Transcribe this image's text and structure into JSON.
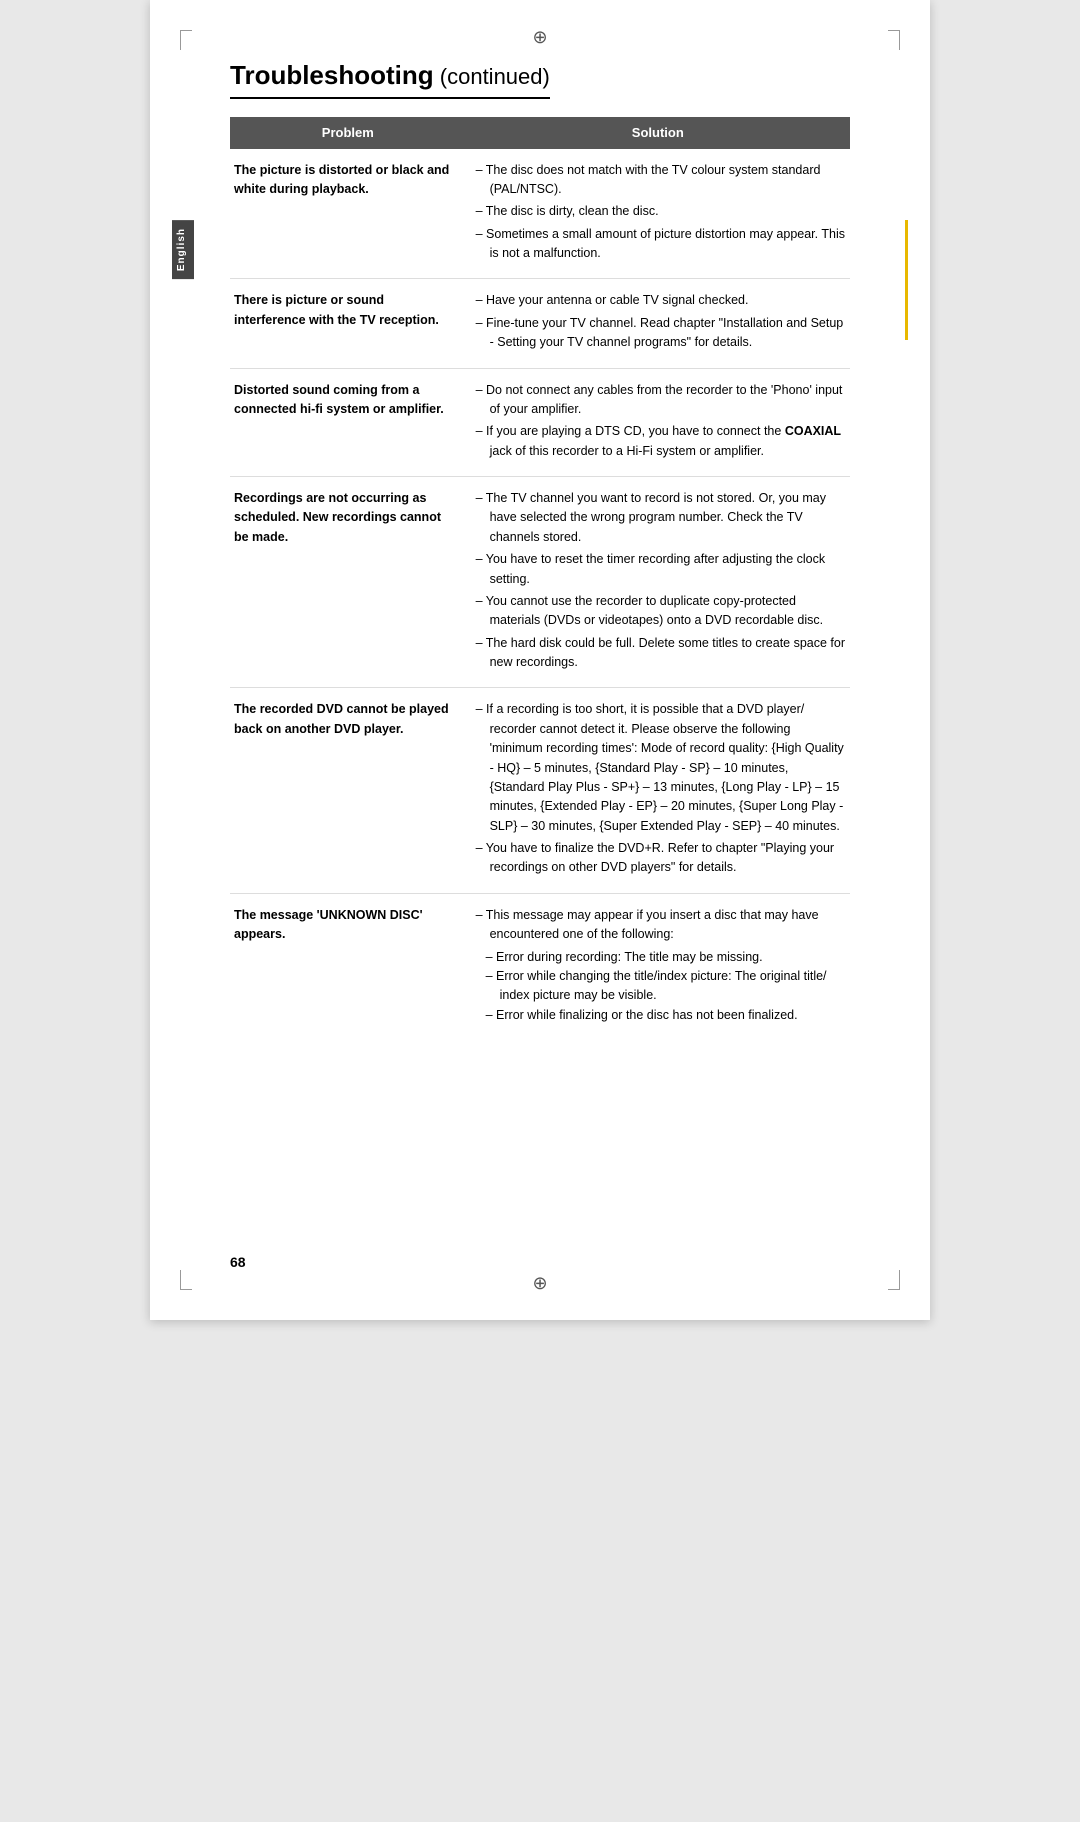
{
  "page": {
    "number": "68",
    "reg_mark": "⊕",
    "sidebar_label": "English",
    "title_bold": "Troubleshooting",
    "title_normal": " (continued)"
  },
  "table": {
    "header": {
      "problem": "Problem",
      "solution": "Solution"
    },
    "rows": [
      {
        "problem": "The picture is distorted or black and white during playback.",
        "solutions": [
          "The disc does not match with the TV colour system standard (PAL/NTSC).",
          "The disc is dirty, clean the disc.",
          "Sometimes a small amount of picture distortion may appear. This is not a malfunction."
        ]
      },
      {
        "problem": "There is picture or sound interference with the TV reception.",
        "solutions": [
          "Have your antenna or cable TV signal checked.",
          "Fine-tune your TV channel. Read chapter \"Installation and Setup - Setting your TV channel programs\" for details."
        ]
      },
      {
        "problem": "Distorted sound coming from a connected hi-fi system or amplifier.",
        "solutions": [
          "Do not connect any cables from the recorder to the 'Phono' input of your amplifier.",
          "If you are playing a DTS CD, you have to connect the COAXIAL jack of this recorder to a Hi-Fi system or amplifier."
        ],
        "bold_keyword": "COAXIAL"
      },
      {
        "problem": "Recordings are not occurring as scheduled. New recordings cannot be made.",
        "solutions": [
          "The TV channel you want to record is not stored. Or, you may have selected the wrong program number. Check the TV channels stored.",
          "You have to reset the timer recording after adjusting the clock setting.",
          "You cannot use the recorder to duplicate copy-protected materials (DVDs or videotapes) onto a DVD recordable disc.",
          "The hard disk could be full. Delete some titles to create space for new recordings."
        ]
      },
      {
        "problem": "The recorded DVD cannot be played back on another DVD player.",
        "solutions": [
          "If a recording is too short, it is possible that a DVD player/ recorder cannot detect it. Please observe the following 'minimum recording times': Mode of record quality: {High Quality - HQ} – 5 minutes, {Standard Play - SP} – 10 minutes, {Standard Play Plus - SP+} – 13 minutes, {Long Play - LP} – 15 minutes, {Extended Play - EP} – 20 minutes, {Super Long Play - SLP} – 30 minutes, {Super Extended Play - SEP} – 40 minutes.",
          "You have to finalize the DVD+R. Refer to chapter \"Playing your recordings on other DVD players\" for details."
        ]
      },
      {
        "problem": "The message 'UNKNOWN DISC' appears.",
        "solutions": [
          "This message may appear if you insert a disc that may have encountered one of the following:"
        ],
        "sub_solutions": [
          "Error during recording: The title may be missing.",
          "Error while changing the title/index picture: The original title/ index picture may be visible.",
          "Error while finalizing or the disc has not been finalized."
        ]
      }
    ]
  }
}
